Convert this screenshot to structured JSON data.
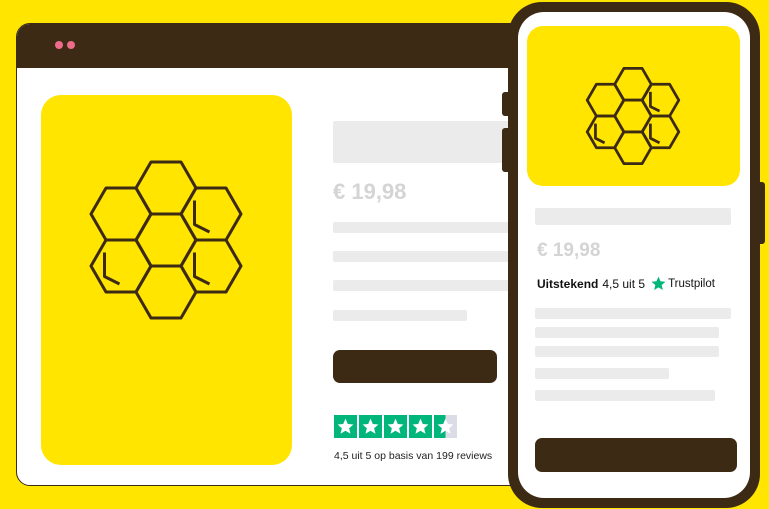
{
  "colors": {
    "brand_yellow": "#FFE500",
    "dark_brown": "#3c2a14",
    "trustpilot_green": "#00b67a",
    "placeholder_gray": "#ebebeb"
  },
  "desktop": {
    "price": "€ 19,98",
    "rating_stars": 4.5,
    "review_summary": "4,5 uit 5 op basis van 199 reviews"
  },
  "mobile": {
    "price": "€ 19,98",
    "rating_label": "Uitstekend",
    "rating_value": "4,5 uit 5",
    "trustpilot_brand": "Trustpilot"
  },
  "icons": {
    "product_image": "honeycomb-icon",
    "star": "star-icon"
  }
}
